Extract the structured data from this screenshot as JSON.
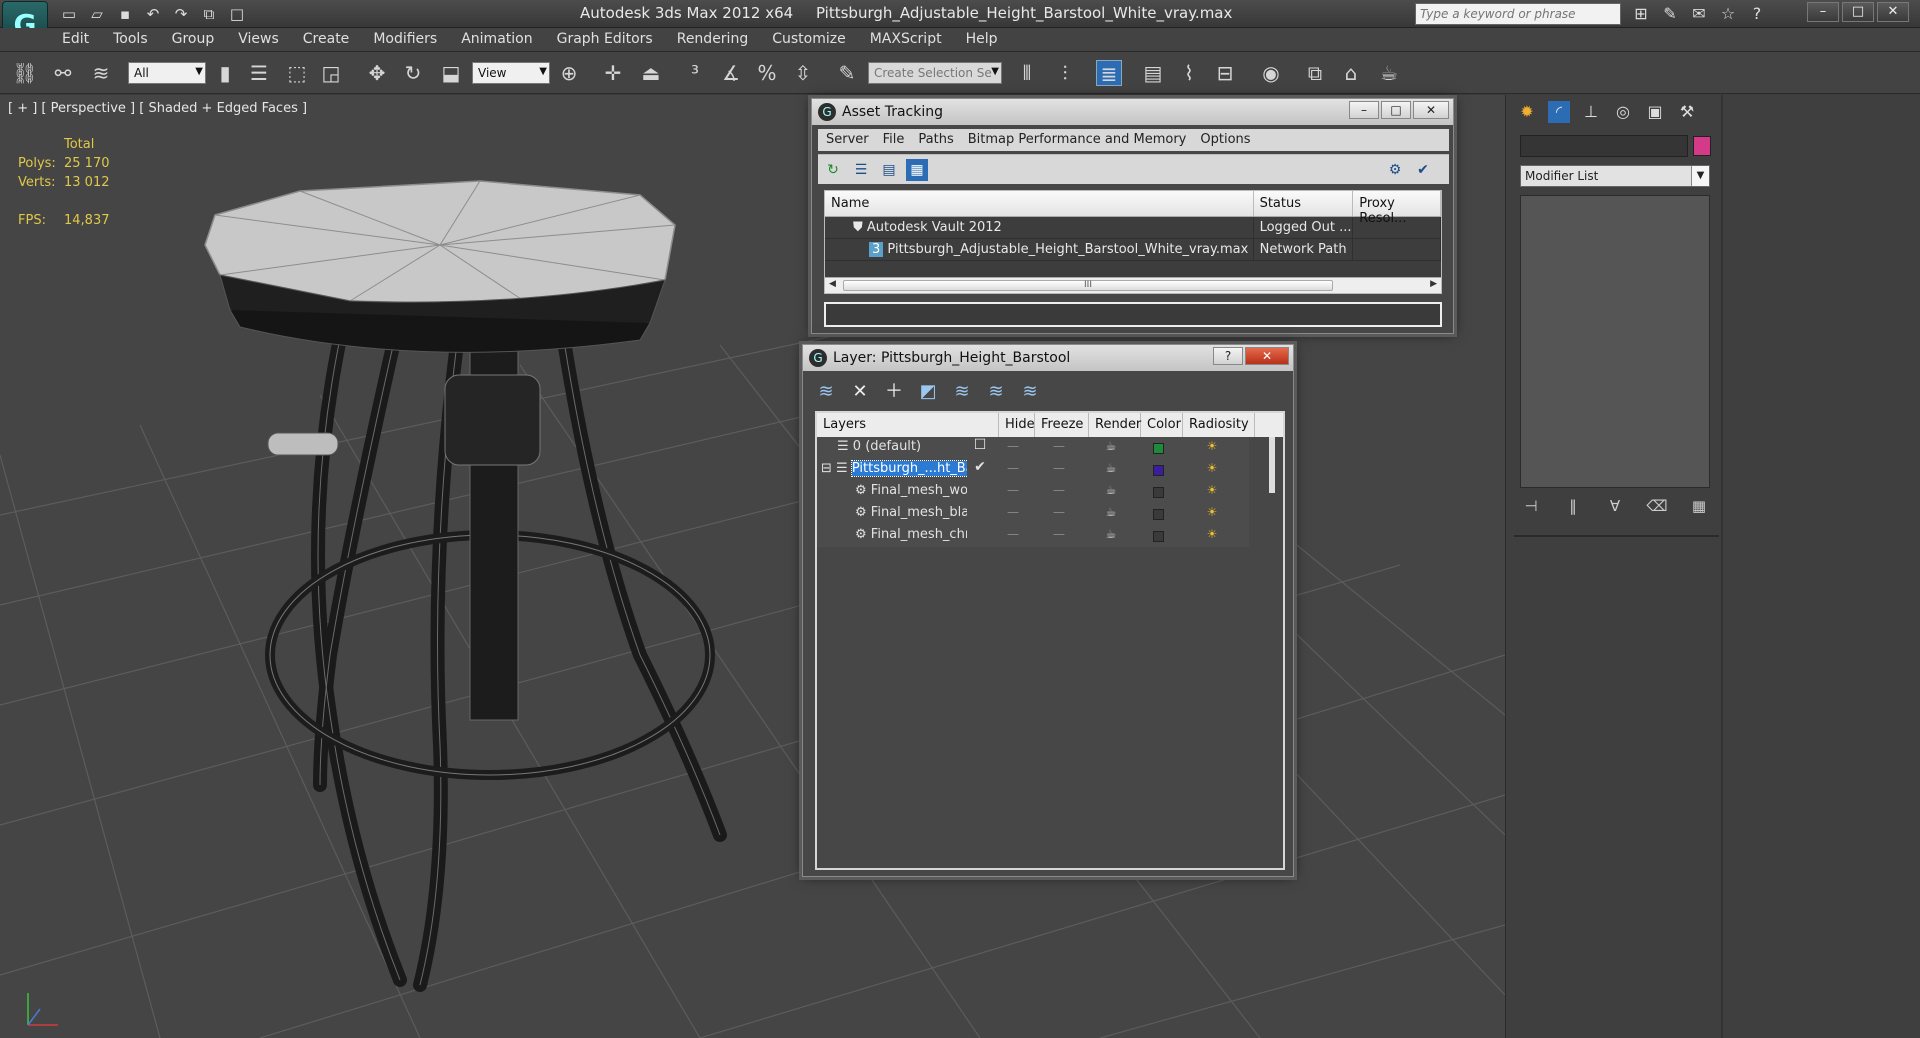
{
  "title_bar": {
    "app_title": "Autodesk 3ds Max  2012 x64",
    "file_name": "Pittsburgh_Adjustable_Height_Barstool_White_vray.max",
    "search_placeholder": "Type a keyword or phrase"
  },
  "menu": [
    "Edit",
    "Tools",
    "Group",
    "Views",
    "Create",
    "Modifiers",
    "Animation",
    "Graph Editors",
    "Rendering",
    "Customize",
    "MAXScript",
    "Help"
  ],
  "toolbar": {
    "filter_select": "All",
    "coord_select": "View",
    "selection_set": "Create Selection Se"
  },
  "viewport": {
    "label": "[ + ] [ Perspective ] [ Shaded + Edged Faces ]",
    "stats_header": "Total",
    "polys_label": "Polys:",
    "polys_value": "25 170",
    "verts_label": "Verts:",
    "verts_value": "13 012",
    "fps_label": "FPS:",
    "fps_value": "14,837"
  },
  "asset_tracking": {
    "title": "Asset Tracking",
    "menu": [
      "Server",
      "File",
      "Paths",
      "Bitmap Performance and Memory",
      "Options"
    ],
    "columns": [
      "Name",
      "Status",
      "Proxy Resol..."
    ],
    "rows": [
      {
        "name": "Autodesk Vault 2012",
        "status": "Logged Out ...",
        "proxy": ""
      },
      {
        "name": "Pittsburgh_Adjustable_Height_Barstool_White_vray.max",
        "status": "Network Path",
        "proxy": ""
      }
    ],
    "scroll_glyph": "III"
  },
  "layer_dialog": {
    "title": "Layer: Pittsburgh_Height_Barstool",
    "columns": [
      "Layers",
      "Hide",
      "Freeze",
      "Render",
      "Color",
      "Radiosity"
    ],
    "rows": [
      {
        "name": "0 (default)",
        "color": "#1e8a3c",
        "selected": false,
        "indent": 0
      },
      {
        "name": "Pittsburgh_...ht_Ba",
        "color": "#3a1e9e",
        "selected": true,
        "indent": 0
      },
      {
        "name": "Final_mesh_woo",
        "color": "#3a3a3a",
        "selected": false,
        "indent": 1
      },
      {
        "name": "Final_mesh_blac",
        "color": "#3a3a3a",
        "selected": false,
        "indent": 1
      },
      {
        "name": "Final_mesh_chro",
        "color": "#3a3a3a",
        "selected": false,
        "indent": 1
      }
    ]
  },
  "command_panel": {
    "modifier_list": "Modifier List",
    "object_color": "#d43a87"
  },
  "colors": {
    "viewport_bg": "#454545",
    "grid_line": "#5a5a5a",
    "stats_text": "#e0c84a",
    "selection": "#2b7ad3"
  }
}
